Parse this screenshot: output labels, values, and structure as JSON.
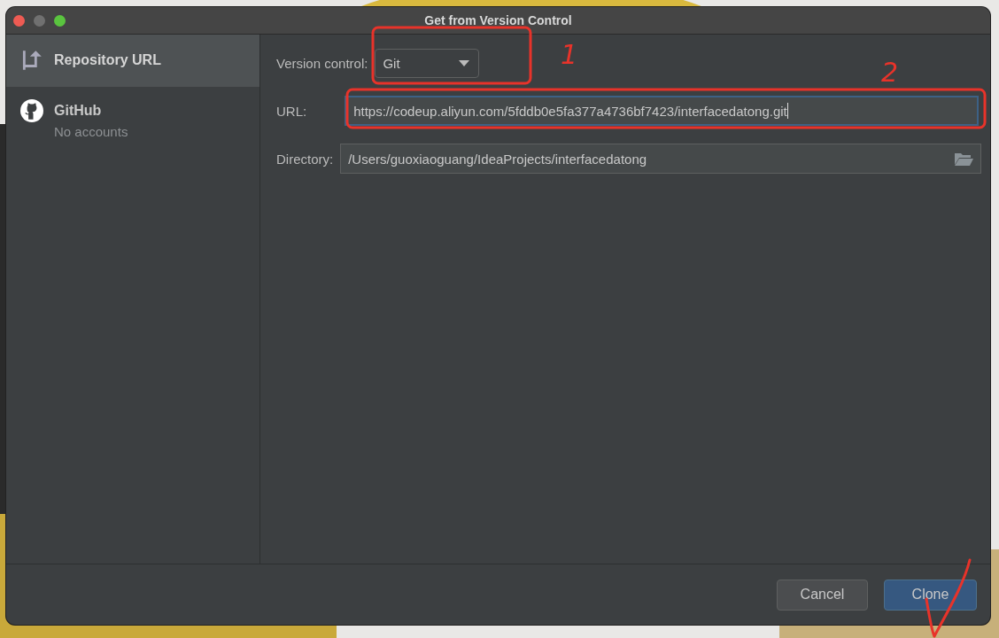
{
  "window": {
    "title": "Get from Version Control"
  },
  "sidebar": {
    "items": [
      {
        "kind": "repository",
        "label": "Repository URL",
        "selected": true
      },
      {
        "kind": "github",
        "label": "GitHub",
        "sublabel": "No accounts",
        "selected": false
      }
    ]
  },
  "form": {
    "version_control": {
      "label": "Version control:",
      "value": "Git"
    },
    "url": {
      "label": "URL:",
      "value": "https://codeup.aliyun.com/5fddb0e5fa377a4736bf7423/interfacedatong.git",
      "focused": true
    },
    "directory": {
      "label": "Directory:",
      "value": "/Users/guoxiaoguang/IdeaProjects/interfacedatong"
    }
  },
  "buttons": [
    {
      "label": "Cancel",
      "kind": "secondary"
    },
    {
      "label": "Clone",
      "kind": "primary"
    }
  ],
  "annotations": [
    {
      "kind": "box"
    },
    {
      "kind": "box"
    },
    {
      "kind": "text",
      "text": "1"
    },
    {
      "kind": "text",
      "text": "2"
    },
    {
      "kind": "check"
    }
  ]
}
